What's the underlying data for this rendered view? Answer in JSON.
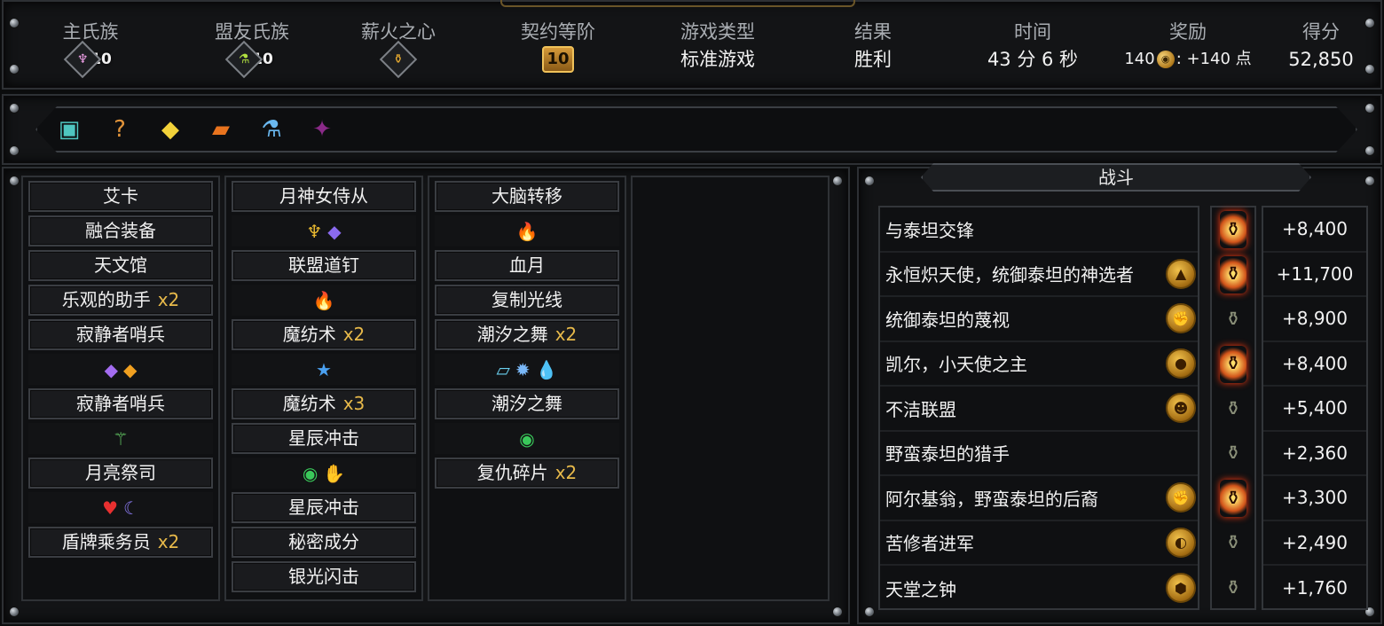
{
  "stats": {
    "main_clan": {
      "label": "主氏族",
      "level": "10",
      "icon": "kin-wings-icon"
    },
    "ally_clan": {
      "label": "盟友氏族",
      "level": "10",
      "icon": "flask-icon"
    },
    "ember_heart": {
      "label": "薪火之心",
      "icon": "ember-lantern-icon"
    },
    "covenant": {
      "label": "契约等阶",
      "value": "10"
    },
    "game_type": {
      "label": "游戏类型",
      "value": "标准游戏"
    },
    "result": {
      "label": "结果",
      "value": "胜利"
    },
    "time": {
      "label": "时间",
      "value": "43 分 6 秒"
    },
    "reward": {
      "label": "奖励",
      "amount": "140",
      "bonus": ": +140 点"
    },
    "score": {
      "label": "得分",
      "value": "52,850"
    }
  },
  "items": [
    {
      "name": "crystal-chest-icon",
      "glyph": "▣",
      "color": "#4fc6c0"
    },
    {
      "name": "mystery-box-icon",
      "glyph": "?",
      "color": "#e0933a"
    },
    {
      "name": "golden-shard-icon",
      "glyph": "◆",
      "color": "#f2d23a"
    },
    {
      "name": "scroll-icon",
      "glyph": "▰",
      "color": "#e8731e"
    },
    {
      "name": "potion-flask-icon",
      "glyph": "⚗",
      "color": "#6ab8f0"
    },
    {
      "name": "dark-wand-icon",
      "glyph": "✦",
      "color": "#8a2a88"
    }
  ],
  "columns": [
    [
      {
        "type": "card",
        "name": "艾卡"
      },
      {
        "type": "card",
        "name": "融合装备"
      },
      {
        "type": "card",
        "name": "天文馆"
      },
      {
        "type": "card",
        "name": "乐观的助手",
        "mult": "x2"
      },
      {
        "type": "card",
        "name": "寂静者哨兵"
      },
      {
        "type": "gems",
        "gems": [
          {
            "glyph": "◆",
            "color": "#a36cf0",
            "icon": "amethyst-gem-icon"
          },
          {
            "glyph": "◆",
            "color": "#f0a020",
            "icon": "amber-gem-icon"
          }
        ]
      },
      {
        "type": "card",
        "name": "寂静者哨兵"
      },
      {
        "type": "gems",
        "gems": [
          {
            "glyph": "⚚",
            "color": "#6ad66a",
            "icon": "sprout-icon"
          }
        ]
      },
      {
        "type": "card",
        "name": "月亮祭司"
      },
      {
        "type": "gems",
        "gems": [
          {
            "glyph": "♥",
            "color": "#e83030",
            "icon": "heart-gem-icon"
          },
          {
            "glyph": "☾",
            "color": "#8a7af0",
            "icon": "crescent-icon"
          }
        ]
      },
      {
        "type": "card",
        "name": "盾牌乘务员",
        "mult": "x2"
      }
    ],
    [
      {
        "type": "card",
        "name": "月神女侍从"
      },
      {
        "type": "gems",
        "gems": [
          {
            "glyph": "♆",
            "color": "#e8b830",
            "icon": "crown-spikes-icon"
          },
          {
            "glyph": "◆",
            "color": "#8a6af0",
            "icon": "violet-gem-icon"
          }
        ]
      },
      {
        "type": "card",
        "name": "联盟道钉"
      },
      {
        "type": "gems",
        "gems": [
          {
            "glyph": "🔥",
            "color": "#f06a20",
            "icon": "flame-icon"
          }
        ]
      },
      {
        "type": "card",
        "name": "魔纺术",
        "mult": "x2"
      },
      {
        "type": "gems",
        "gems": [
          {
            "glyph": "★",
            "color": "#4aa0f0",
            "icon": "blue-star-icon"
          }
        ]
      },
      {
        "type": "card",
        "name": "魔纺术",
        "mult": "x3"
      },
      {
        "type": "card",
        "name": "星辰冲击"
      },
      {
        "type": "gems",
        "gems": [
          {
            "glyph": "◉",
            "color": "#3ac85a",
            "icon": "green-eye-icon"
          },
          {
            "glyph": "✋",
            "color": "#b070e0",
            "icon": "purple-hand-icon"
          }
        ]
      },
      {
        "type": "card",
        "name": "星辰冲击"
      },
      {
        "type": "card",
        "name": "秘密成分"
      },
      {
        "type": "card",
        "name": "银光闪击"
      }
    ],
    [
      {
        "type": "card",
        "name": "大脑转移"
      },
      {
        "type": "gems",
        "gems": [
          {
            "glyph": "🔥",
            "color": "#f06a20",
            "icon": "flame-icon"
          }
        ]
      },
      {
        "type": "card",
        "name": "血月"
      },
      {
        "type": "card",
        "name": "复制光线"
      },
      {
        "type": "card",
        "name": "潮汐之舞",
        "mult": "x2"
      },
      {
        "type": "gems",
        "gems": [
          {
            "glyph": "▱",
            "color": "#6ad0f0",
            "icon": "blue-shard-icon"
          },
          {
            "glyph": "✹",
            "color": "#7ab8f8",
            "icon": "frost-burst-icon"
          },
          {
            "glyph": "💧",
            "color": "#a050f0",
            "icon": "purple-drop-icon"
          }
        ]
      },
      {
        "type": "card",
        "name": "潮汐之舞"
      },
      {
        "type": "gems",
        "gems": [
          {
            "glyph": "◉",
            "color": "#3ac85a",
            "icon": "green-eye-icon"
          }
        ]
      },
      {
        "type": "card",
        "name": "复仇碎片",
        "mult": "x2"
      }
    ],
    []
  ],
  "combat": {
    "title": "战斗",
    "rows": [
      {
        "name": "与泰坦交锋",
        "enemy_icon": "",
        "lit": true,
        "score": "+8,400"
      },
      {
        "name": "永恒炽天使，统御泰坦的神选者",
        "enemy_icon": "▲",
        "lit": true,
        "score": "+11,700"
      },
      {
        "name": "统御泰坦的蔑视",
        "enemy_icon": "✊",
        "lit": false,
        "score": "+8,900"
      },
      {
        "name": "凯尔，小天使之主",
        "enemy_icon": "●",
        "lit": true,
        "score": "+8,400"
      },
      {
        "name": "不洁联盟",
        "enemy_icon": "☻",
        "lit": false,
        "score": "+5,400"
      },
      {
        "name": "野蛮泰坦的猎手",
        "enemy_icon": "",
        "lit": false,
        "score": "+2,360"
      },
      {
        "name": "阿尔基翁，野蛮泰坦的后裔",
        "enemy_icon": "✊",
        "lit": true,
        "score": "+3,300"
      },
      {
        "name": "苦修者进军",
        "enemy_icon": "◐",
        "lit": false,
        "score": "+2,490"
      },
      {
        "name": "天堂之钟",
        "enemy_icon": "⬢",
        "lit": false,
        "score": "+1,760"
      }
    ]
  }
}
